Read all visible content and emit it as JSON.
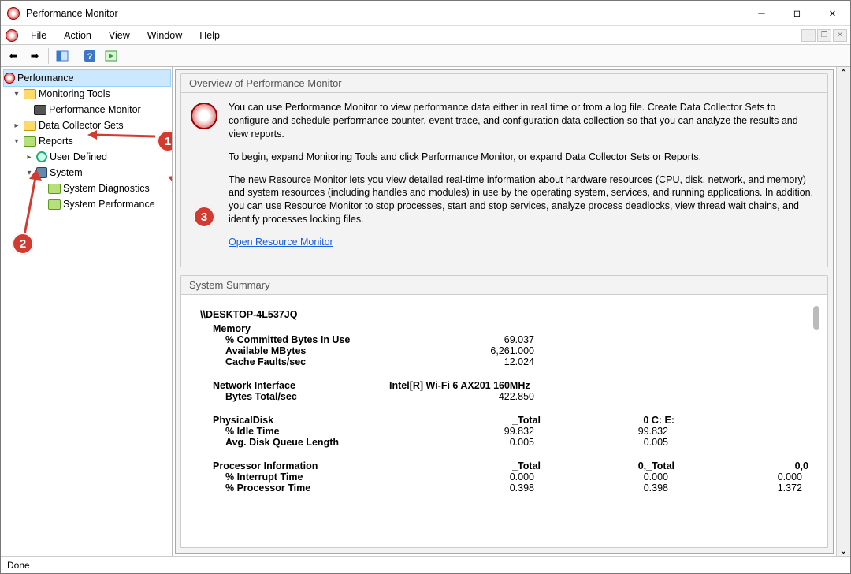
{
  "window": {
    "title": "Performance Monitor"
  },
  "menu": {
    "file": "File",
    "action": "Action",
    "view": "View",
    "window": "Window",
    "help": "Help"
  },
  "tree": {
    "root": "Performance",
    "monitoring_tools": "Monitoring Tools",
    "perf_monitor": "Performance Monitor",
    "dcs": "Data Collector Sets",
    "reports": "Reports",
    "user_defined": "User Defined",
    "system": "System",
    "sys_diag": "System Diagnostics",
    "sys_perf": "System Performance"
  },
  "overview": {
    "heading": "Overview of Performance Monitor",
    "p1": "You can use Performance Monitor to view performance data either in real time or from a log file. Create Data Collector Sets to configure and schedule performance counter, event trace, and configuration data collection so that you can analyze the results and view reports.",
    "p2": "To begin, expand Monitoring Tools and click Performance Monitor, or expand Data Collector Sets or Reports.",
    "p3": "The new Resource Monitor lets you view detailed real-time information about hardware resources (CPU, disk, network, and memory) and system resources (including handles and modules) in use by the operating system, services, and running applications. In addition, you can use Resource Monitor to stop processes, start and stop services, analyze process deadlocks, view thread wait chains, and identify processes locking files.",
    "link": "Open Resource Monitor"
  },
  "summary": {
    "heading": "System Summary",
    "host": "\\\\DESKTOP-4L537JQ",
    "memory": {
      "label": "Memory",
      "committed_label": "% Committed Bytes In Use",
      "committed": "69.037",
      "available_label": "Available MBytes",
      "available": "6,261.000",
      "cachefaults_label": "Cache Faults/sec",
      "cachefaults": "12.024"
    },
    "net": {
      "label": "Network Interface",
      "iface": "Intel[R] Wi-Fi 6 AX201 160MHz",
      "bytes_label": "Bytes Total/sec",
      "bytes": "422.850"
    },
    "disk": {
      "label": "PhysicalDisk",
      "col1": "_Total",
      "col2": "0 C: E:",
      "idle_label": "% Idle Time",
      "idle1": "99.832",
      "idle2": "99.832",
      "queue_label": "Avg. Disk Queue Length",
      "queue1": "0.005",
      "queue2": "0.005"
    },
    "proc": {
      "label": "Processor Information",
      "col1": "_Total",
      "col2": "0,_Total",
      "col3": "0,0",
      "int_label": "% Interrupt Time",
      "int1": "0.000",
      "int2": "0.000",
      "int3": "0.000",
      "pt_label": "% Processor Time",
      "pt1": "0.398",
      "pt2": "0.398",
      "pt3": "1.372"
    }
  },
  "status": "Done",
  "annotations": {
    "b1": "1",
    "b2": "2",
    "b3": "3"
  }
}
